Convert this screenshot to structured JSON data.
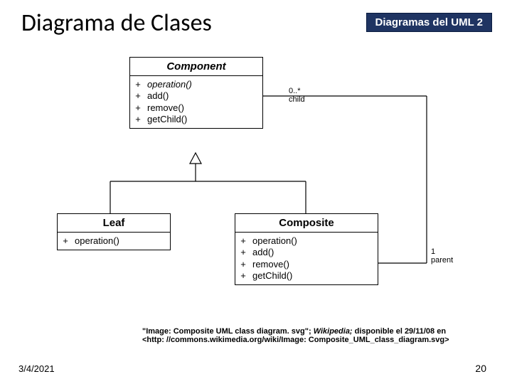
{
  "title": "Diagrama de Clases",
  "badge": "Diagramas del UML 2",
  "uml": {
    "component": {
      "name": "Component",
      "ops": [
        {
          "vis": "+",
          "name": "operation()",
          "abstract": true
        },
        {
          "vis": "+",
          "name": "add()"
        },
        {
          "vis": "+",
          "name": "remove()"
        },
        {
          "vis": "+",
          "name": "getChild()"
        }
      ]
    },
    "leaf": {
      "name": "Leaf",
      "ops": [
        {
          "vis": "+",
          "name": "operation()"
        }
      ]
    },
    "composite": {
      "name": "Composite",
      "ops": [
        {
          "vis": "+",
          "name": "operation()"
        },
        {
          "vis": "+",
          "name": "add()"
        },
        {
          "vis": "+",
          "name": "remove()"
        },
        {
          "vis": "+",
          "name": "getChild()"
        }
      ]
    },
    "assoc": {
      "child": {
        "mult": "0..*",
        "role": "child"
      },
      "parent": {
        "mult": "1",
        "role": "parent"
      }
    }
  },
  "citation": {
    "lead": "\"Image: Composite UML class diagram. svg\"; ",
    "src": "Wikipedia; ",
    "tail": " disponible el 29/11/08 en",
    "url": "<http: //commons.wikimedia.org/wiki/Image: Composite_UML_class_diagram.svg>"
  },
  "footer": {
    "date": "3/4/2021",
    "page": "20"
  }
}
